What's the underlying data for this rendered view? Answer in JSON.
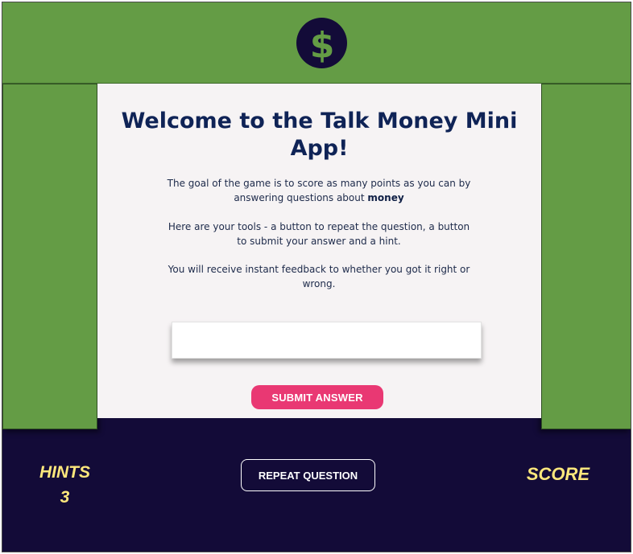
{
  "header": {
    "logo_icon": "dollar-icon",
    "logo_symbol": "$",
    "colors": {
      "green": "#649c45",
      "navy": "#130b38",
      "logo_symbol": "#649c45"
    }
  },
  "welcome": {
    "title": "Welcome to the Talk Money Mini App!",
    "para1_prefix": "The goal of the game is to score as many points as you can by answering questions about",
    "para1_bold": "money",
    "para2": "Here are your tools - a button to repeat the question, a button to submit your answer and a hint.",
    "para3": "You will receive instant feedback to whether you got it right or wrong."
  },
  "answer_input": {
    "value": "",
    "placeholder": ""
  },
  "buttons": {
    "submit_label": "SUBMIT ANSWER",
    "repeat_label": "REPEAT QUESTION",
    "submit_color": "#e93873"
  },
  "footer": {
    "hints_label": "HINTS",
    "hints_count": "3",
    "score_label": "SCORE",
    "label_color": "#fde77c"
  }
}
